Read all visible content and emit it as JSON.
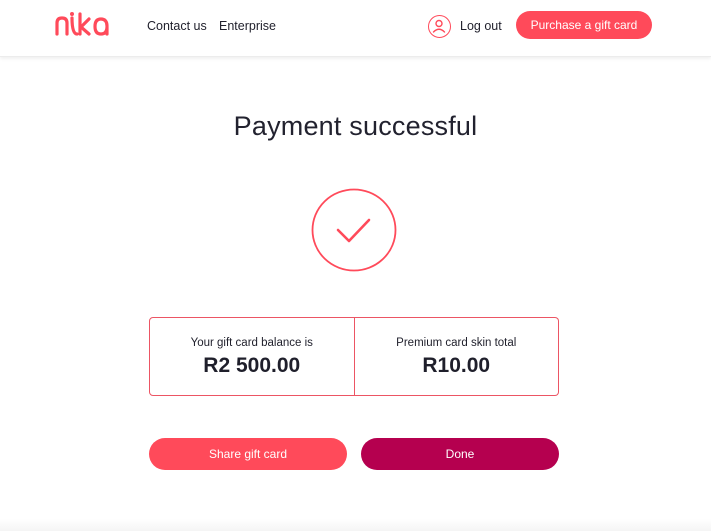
{
  "brand": {
    "logo_text": "nika",
    "accent_color": "#ff4a5a",
    "done_color": "#b5004f"
  },
  "header": {
    "nav": {
      "contact_label": "Contact us",
      "enterprise_label": "Enterprise"
    },
    "logout_label": "Log out",
    "purchase_label": "Purchase a gift card"
  },
  "main": {
    "title": "Payment successful",
    "status_icon": "check-icon",
    "summary": {
      "balance_label": "Your gift card balance is",
      "balance_value": "R2 500.00",
      "skin_label": "Premium card skin total",
      "skin_value": "R10.00"
    },
    "actions": {
      "share_label": "Share gift card",
      "done_label": "Done"
    }
  }
}
